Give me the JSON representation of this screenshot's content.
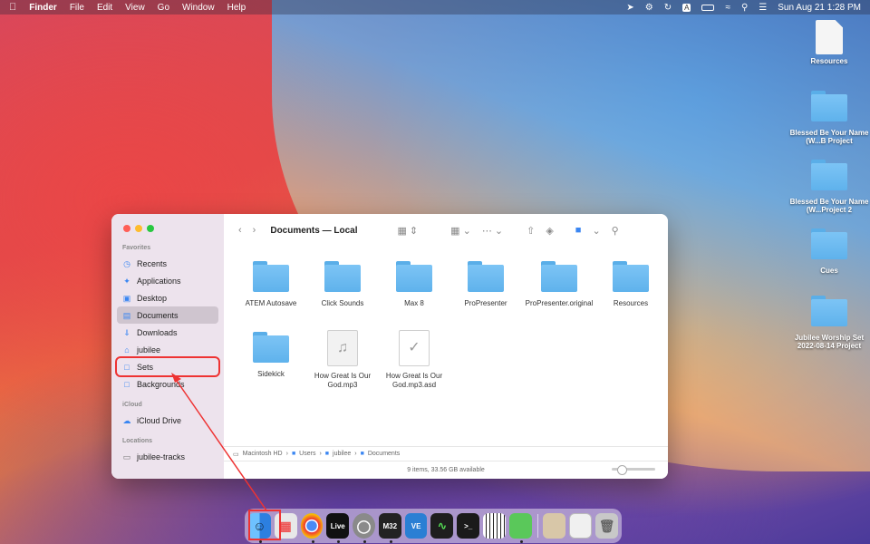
{
  "menubar": {
    "app_name": "Finder",
    "items": [
      "File",
      "Edit",
      "View",
      "Go",
      "Window",
      "Help"
    ],
    "clock": "Sun Aug 21  1:28 PM",
    "input_letter": "A"
  },
  "desktop": {
    "items": [
      {
        "label": "Resources",
        "type": "file"
      },
      {
        "label": "Blessed Be Your Name (W...B Project",
        "type": "folder"
      },
      {
        "label": "Blessed Be Your Name (W...Project 2",
        "type": "folder"
      },
      {
        "label": "Cues",
        "type": "folder"
      },
      {
        "label": "Jubilee Worship Set 2022-08-14 Project",
        "type": "folder"
      }
    ]
  },
  "finder": {
    "title": "Documents — Local",
    "sidebar": {
      "favorites_header": "Favorites",
      "favorites": [
        {
          "label": "Recents",
          "icon": "clock-icon"
        },
        {
          "label": "Applications",
          "icon": "applications-icon"
        },
        {
          "label": "Desktop",
          "icon": "desktop-icon"
        },
        {
          "label": "Documents",
          "icon": "document-icon",
          "active": true
        },
        {
          "label": "Downloads",
          "icon": "download-icon"
        },
        {
          "label": "jubilee",
          "icon": "home-icon"
        },
        {
          "label": "Sets",
          "icon": "folder-icon",
          "highlighted": true
        },
        {
          "label": "Backgrounds",
          "icon": "folder-icon"
        }
      ],
      "icloud_header": "iCloud",
      "icloud": [
        {
          "label": "iCloud Drive",
          "icon": "cloud-icon"
        }
      ],
      "locations_header": "Locations",
      "locations": [
        {
          "label": "jubilee-tracks",
          "icon": "drive-icon"
        }
      ]
    },
    "files": [
      {
        "name": "ATEM Autosave",
        "type": "folder"
      },
      {
        "name": "Click Sounds",
        "type": "folder"
      },
      {
        "name": "Max 8",
        "type": "folder"
      },
      {
        "name": "ProPresenter",
        "type": "folder"
      },
      {
        "name": "ProPresenter.original",
        "type": "folder"
      },
      {
        "name": "Resources",
        "type": "folder"
      },
      {
        "name": "Sidekick",
        "type": "folder"
      },
      {
        "name": "How Great Is Our God.mp3",
        "type": "audio"
      },
      {
        "name": "How Great Is Our God.mp3.asd",
        "type": "doc"
      }
    ],
    "path": [
      "Macintosh HD",
      "Users",
      "jubilee",
      "Documents"
    ],
    "status": "9 items, 33.56 GB available"
  },
  "dock": {
    "apps": [
      {
        "name": "finder",
        "color": "#3a8ee6",
        "label": "",
        "running": true
      },
      {
        "name": "launchpad",
        "color": "#e8e8e8",
        "label": "",
        "running": false
      },
      {
        "name": "chrome",
        "color": "#ffffff",
        "label": "",
        "running": true
      },
      {
        "name": "ableton-live",
        "color": "#111111",
        "label": "Live",
        "running": true
      },
      {
        "name": "mouse-app",
        "color": "#8a8a8a",
        "label": "",
        "running": true
      },
      {
        "name": "m32-edit",
        "color": "#222222",
        "label": "M32",
        "running": true
      },
      {
        "name": "ve-app",
        "color": "#2a7fd4",
        "label": "VE",
        "running": false
      },
      {
        "name": "activity-monitor",
        "color": "#1e1e1e",
        "label": "",
        "running": false
      },
      {
        "name": "terminal",
        "color": "#1a1a1a",
        "label": ">_",
        "running": false
      },
      {
        "name": "piano-app",
        "color": "#333333",
        "label": "",
        "running": false
      },
      {
        "name": "green-app",
        "color": "#5ac85a",
        "label": "",
        "running": true
      }
    ],
    "others": [
      {
        "name": "stack-folder",
        "color": "#d8c7a8"
      },
      {
        "name": "window-preview",
        "color": "#f0f0f0"
      },
      {
        "name": "trash",
        "color": "#c8c8c8"
      }
    ]
  },
  "colors": {
    "accent": "#3a86f2",
    "annotation": "#e33333"
  }
}
